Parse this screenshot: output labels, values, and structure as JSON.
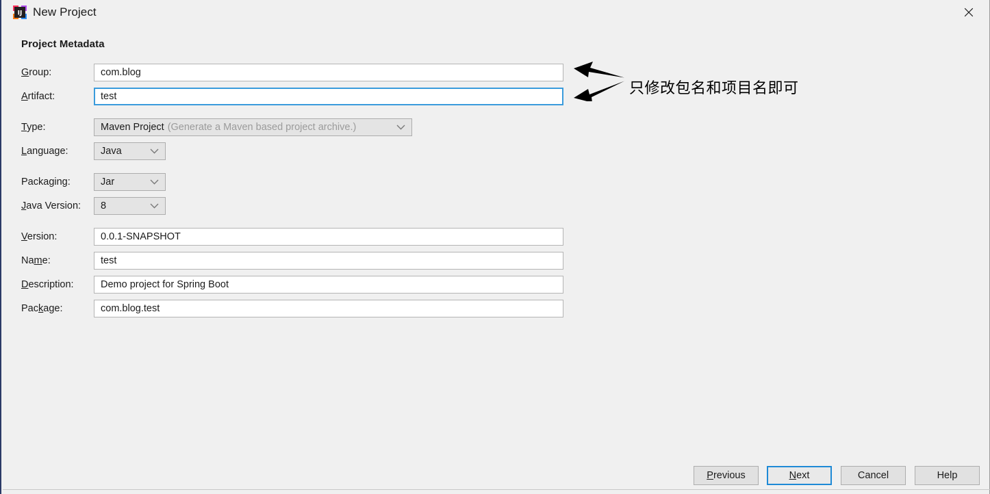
{
  "window": {
    "title": "New Project",
    "icon": "intellij-idea-icon",
    "close_label": "✕"
  },
  "section": {
    "title": "Project Metadata"
  },
  "form": {
    "group": {
      "label": "Group:",
      "mnemonic": "G",
      "value": "com.blog",
      "focused": false
    },
    "artifact": {
      "label": "Artifact:",
      "mnemonic": "A",
      "value": "test",
      "focused": true
    },
    "type": {
      "label": "Type:",
      "mnemonic": "T",
      "value": "Maven Project",
      "hint": "(Generate a Maven based project archive.)"
    },
    "language": {
      "label": "Language:",
      "mnemonic": "L",
      "value": "Java"
    },
    "packaging": {
      "label": "Packaging:",
      "mnemonic": "g",
      "value": "Jar"
    },
    "java_version": {
      "label": "Java Version:",
      "mnemonic": "J",
      "value": "8"
    },
    "version": {
      "label": "Version:",
      "mnemonic": "V",
      "value": "0.0.1-SNAPSHOT"
    },
    "name": {
      "label": "Name:",
      "mnemonic": "m",
      "value": "test"
    },
    "description": {
      "label": "Description:",
      "mnemonic": "D",
      "value": "Demo project for Spring Boot"
    },
    "package": {
      "label": "Package:",
      "mnemonic": "k",
      "value": "com.blog.test"
    }
  },
  "annotation": {
    "text": "只修改包名和项目名即可",
    "color": "#000000",
    "arrow_count": 2
  },
  "footer": {
    "previous": "Previous",
    "previous_mnemonic": "P",
    "next": "Next",
    "next_mnemonic": "N",
    "cancel": "Cancel",
    "help": "Help"
  },
  "colors": {
    "background": "#f0f0f0",
    "focus_blue": "#3a9bdc",
    "default_button_blue": "#1e8ad6",
    "field_white": "#ffffff",
    "field_border": "#b4b4b4",
    "combo_background": "#e4e4e4",
    "hint_gray": "#9b9b9b",
    "text": "#1b1b1b"
  }
}
